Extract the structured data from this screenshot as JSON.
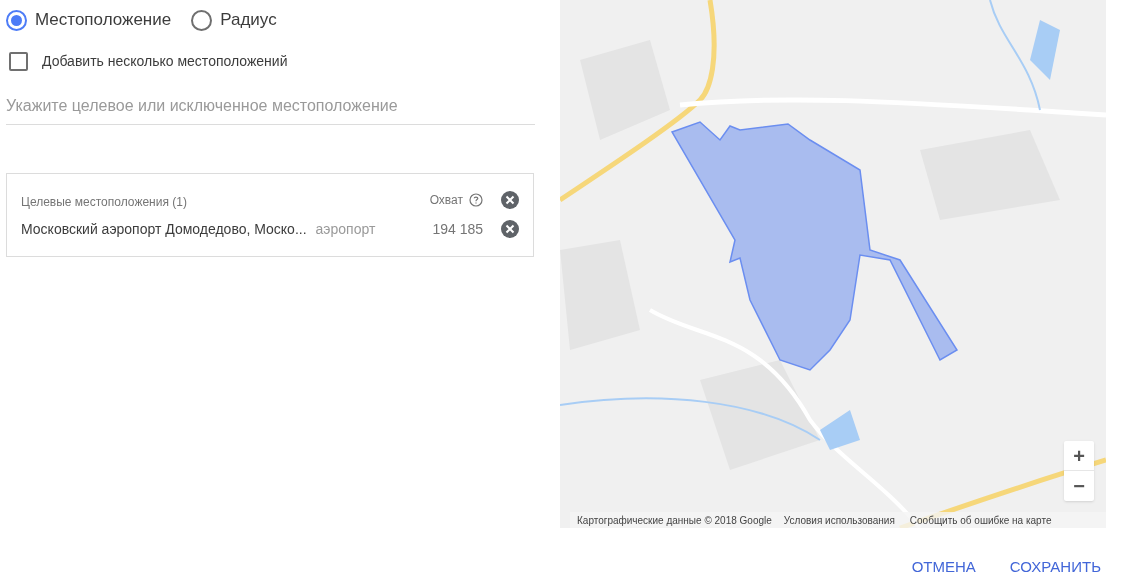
{
  "location_mode": [
    {
      "label": "Местоположение",
      "selected": true
    },
    {
      "label": "Радиус",
      "selected": false
    }
  ],
  "multiple_locations": {
    "label": "Добавить несколько местоположений",
    "checked": false
  },
  "location_search": {
    "placeholder": "Укажите целевое или исключенное местоположение"
  },
  "targeted_locations": {
    "title": "Целевые местоположения (1)",
    "reach_label": "Охват",
    "rows": [
      {
        "name": "Московский аэропорт Домодедово, Моско...",
        "type": "аэропорт",
        "reach": "194 185"
      }
    ]
  },
  "map": {
    "kind": "picture",
    "zoom_in": "+",
    "zoom_out": "−",
    "attribution": "Картографические данные © 2018 Google",
    "terms": "Условия использования",
    "report": "Сообщить об ошибке на карте"
  },
  "buttons": [
    {
      "label": "ОТМЕНА"
    },
    {
      "label": "СОХРАНИТЬ"
    }
  ]
}
